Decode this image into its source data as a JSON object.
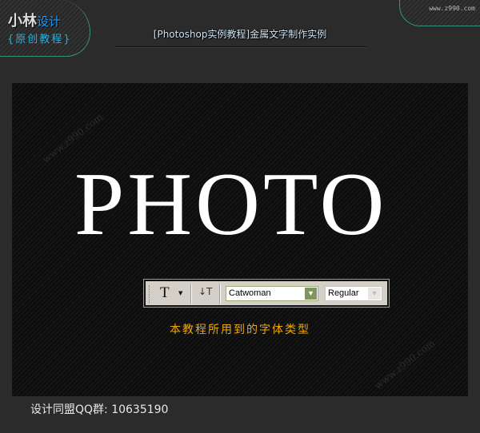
{
  "header": {
    "logo_main": "小林",
    "logo_accent": "设计",
    "logo_sub": "{原创教程}",
    "site": "www.z990.com",
    "title": "[Photoshop实例教程]金属文字制作实例"
  },
  "canvas": {
    "watermark": "www.z990.com",
    "headline": "PHOTO",
    "caption": "本教程所用到的字体类型"
  },
  "toolbar": {
    "text_tool_icon": "type-tool-icon",
    "orientation_icon": "text-orientation-icon",
    "font_family": "Catwoman",
    "font_style": "Regular"
  },
  "footer": {
    "text": "设计同盟QQ群: 10635190"
  },
  "colors": {
    "background": "#2b2b2b",
    "caption": "#f0a800",
    "logo_accent": "#1e9cff",
    "outline": "#3a8f7f"
  }
}
